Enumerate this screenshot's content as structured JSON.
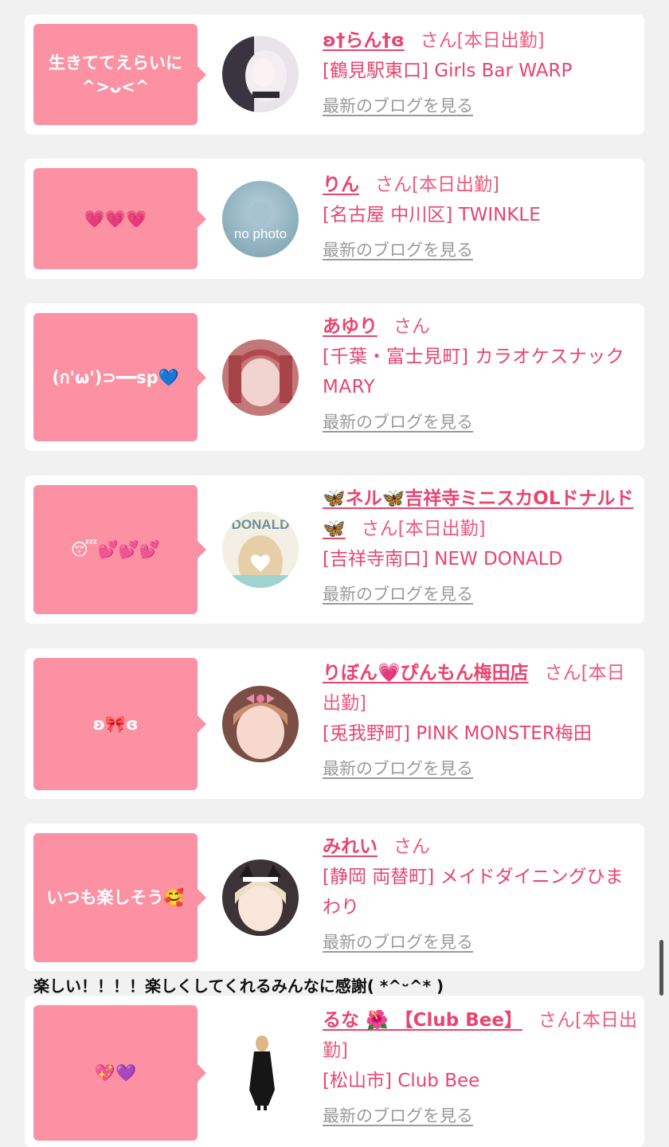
{
  "cards": [
    {
      "bubble": "生きててえらいに ^>ᴗ<^",
      "name": "ʚ†らん†ɞ",
      "suffix": "さん[本日出勤]",
      "shop": "[鶴見駅東口] Girls Bar WARP",
      "blog": "最新のブログを見る"
    },
    {
      "bubble": "💗💗💗",
      "name": "りん",
      "suffix": "さん[本日出勤]",
      "shop": "[名古屋 中川区] TWINKLE",
      "blog": "最新のブログを見る",
      "avatar_text": "no photo"
    },
    {
      "bubble": "(ก'ω')⊃━━sp💙",
      "name": "あゆり",
      "suffix": "さん",
      "shop": "[千葉・富士見町] カラオケスナック MARY",
      "blog": "最新のブログを見る"
    },
    {
      "bubble": "😴💕💕💕",
      "name": "🦋ネル🦋吉祥寺ミニスカOLドナルド🦋",
      "suffix": "さん[本日出勤]",
      "shop": "[吉祥寺南口] NEW DONALD",
      "blog": "最新のブログを見る",
      "avatar_text": "DONALD"
    },
    {
      "bubble": "ʚ🎀ɞ",
      "name": "りぼん💗ぴんもん梅田店",
      "suffix": "さん[本日出勤]",
      "shop": "[兎我野町] PINK MONSTER梅田",
      "blog": "最新のブログを見る"
    },
    {
      "bubble": "いつも楽しそう🥰",
      "name": "みれい",
      "suffix": "さん",
      "shop": "[静岡 両替町] メイドダイニングひまわり",
      "blog": "最新のブログを見る"
    },
    {
      "bubble": "💖💜",
      "name": "るな 🌺 【Club Bee】",
      "suffix": "さん[本日出勤]",
      "shop": "[松山市] Club Bee",
      "blog": "最新のブログを見る"
    }
  ],
  "comment": "楽しい！！！！楽しくしてくれるみんなに感謝( *^ᵕ^* )"
}
